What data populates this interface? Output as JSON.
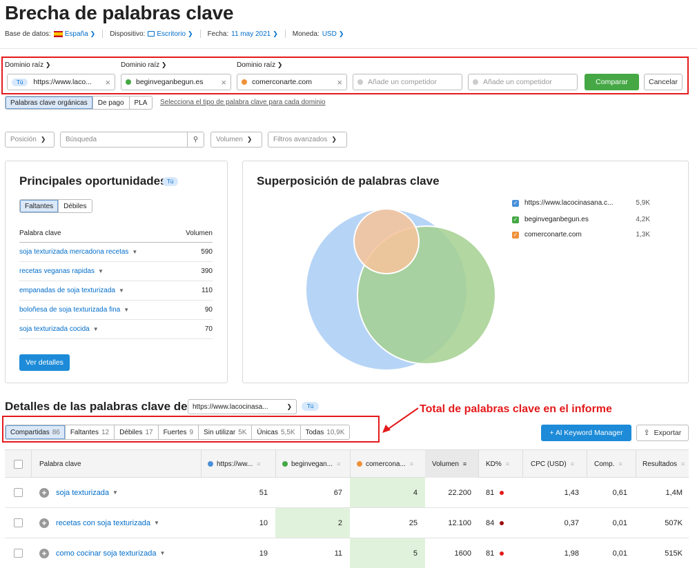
{
  "page": {
    "title": "Brecha de palabras clave",
    "meta": {
      "db_label": "Base de datos:",
      "db_value": "España",
      "device_label": "Dispositivo:",
      "device_value": "Escritorio",
      "date_label": "Fecha:",
      "date_value": "11 may 2021",
      "currency_label": "Moneda:",
      "currency_value": "USD"
    }
  },
  "domains": {
    "label": "Dominio raíz",
    "you_badge": "Tú",
    "d1": "https://www.laco...",
    "d2": "beginveganbegun.es",
    "d3": "comerconarte.com",
    "add_placeholder": "Añade un competidor",
    "compare": "Comparar",
    "cancel": "Cancelar"
  },
  "type_tabs": [
    "Palabras clave orgánicas",
    "De pago",
    "PLA"
  ],
  "type_hint": "Selecciona el tipo de palabra clave para cada dominio",
  "filters": {
    "position": "Posición",
    "search_placeholder": "Búsqueda",
    "volume": "Volumen",
    "advanced": "Filtros avanzados"
  },
  "opportunities": {
    "title": "Principales oportunidades",
    "badge": "Tú",
    "tabs": [
      "Faltantes",
      "Débiles"
    ],
    "col_keyword": "Palabra clave",
    "col_volume": "Volumen",
    "rows": [
      {
        "kw": "soja texturizada mercadona recetas",
        "vol": "590"
      },
      {
        "kw": "recetas veganas rapidas",
        "vol": "390"
      },
      {
        "kw": "empanadas de soja texturizada",
        "vol": "110"
      },
      {
        "kw": "boloñesa de soja texturizada fina",
        "vol": "90"
      },
      {
        "kw": "soja texturizada cocida",
        "vol": "70"
      }
    ],
    "button": "Ver detalles"
  },
  "overlap": {
    "title": "Superposición de palabras clave",
    "legend": [
      {
        "name": "https://www.lacocinasana.c...",
        "value": "5,9K",
        "color": "#4a90d9"
      },
      {
        "name": "beginveganbegun.es",
        "value": "4,2K",
        "color": "#45a845"
      },
      {
        "name": "comerconarte.com",
        "value": "1,3K",
        "color": "#f0913a"
      }
    ]
  },
  "details": {
    "title": "Detalles de las palabras clave de:",
    "domain_select": "https://www.lacocinasa...",
    "badge": "Tú",
    "annotation": "Total de palabras clave en el informe",
    "tabs": [
      {
        "label": "Compartidas",
        "count": "86"
      },
      {
        "label": "Faltantes",
        "count": "12"
      },
      {
        "label": "Débiles",
        "count": "17"
      },
      {
        "label": "Fuertes",
        "count": "9"
      },
      {
        "label": "Sin utilizar",
        "count": "5K"
      },
      {
        "label": "Únicas",
        "count": "5,5K"
      },
      {
        "label": "Todas",
        "count": "10,9K"
      }
    ],
    "km_button": "+ Al Keyword Manager",
    "export_button": "Exportar"
  },
  "table": {
    "headers": {
      "keyword": "Palabra clave",
      "d1": "https://ww...",
      "d2": "beginvegan...",
      "d3": "comercona...",
      "volume": "Volumen",
      "kd": "KD%",
      "cpc": "CPC (USD)",
      "comp": "Comp.",
      "results": "Resultados"
    },
    "rows": [
      {
        "kw": "soja texturizada",
        "d1": "51",
        "d2": "67",
        "d3": "4",
        "vol": "22.200",
        "kd": "81",
        "cpc": "1,43",
        "comp": "0,61",
        "res": "1,4M"
      },
      {
        "kw": "recetas con soja texturizada",
        "d1": "10",
        "d2": "2",
        "d3": "25",
        "vol": "12.100",
        "kd": "84",
        "cpc": "0,37",
        "comp": "0,01",
        "res": "507K"
      },
      {
        "kw": "como cocinar soja texturizada",
        "d1": "19",
        "d2": "11",
        "d3": "5",
        "vol": "1600",
        "kd": "81",
        "cpc": "1,98",
        "comp": "0,01",
        "res": "515K"
      }
    ]
  }
}
